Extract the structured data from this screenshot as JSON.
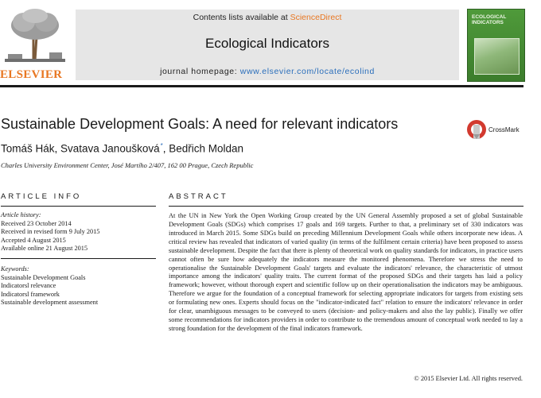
{
  "header": {
    "publisher_logo_text": "ELSEVIER",
    "contents_prefix": "Contents lists available at ",
    "contents_link": "ScienceDirect",
    "journal_name": "Ecological Indicators",
    "homepage_prefix": "journal homepage: ",
    "homepage_url": "www.elsevier.com/locate/ecolind",
    "cover_title": "ECOLOGICAL INDICATORS",
    "accent_color": "#e87722",
    "link_color": "#2a6ebb"
  },
  "article": {
    "title": "Sustainable Development Goals: A need for relevant indicators",
    "authors_a": "Tomáš Hák, Svatava Janoušková",
    "corresponding_mark": "*",
    "authors_b": ", Bedřich Moldan",
    "affiliation": "Charles University Environment Center, José Martího 2/407, 162 00 Prague, Czech Republic",
    "crossmark_label": "CrossMark"
  },
  "article_info": {
    "heading": "ARTICLE INFO",
    "history_label": "Article history:",
    "history": [
      "Received 23 October 2014",
      "Received in revised form 9 July 2015",
      "Accepted 4 August 2015",
      "Available online 21 August 2015"
    ],
    "keywords_label": "Keywords:",
    "keywords": [
      "Sustainable Development Goals",
      "Indicatorsl relevance",
      "Indicatorsl framework",
      "Sustainable development assessment"
    ]
  },
  "abstract": {
    "heading": "ABSTRACT",
    "text": "At the UN in New York the Open Working Group created by the UN General Assembly proposed a set of global Sustainable Development Goals (SDGs) which comprises 17 goals and 169 targets. Further to that, a preliminary set of 330 indicators was introduced in March 2015. Some SDGs build on preceding Millennium Development Goals while others incorporate new ideas. A critical review has revealed that indicators of varied quality (in terms of the fulfilment certain criteria) have been proposed to assess sustainable development. Despite the fact that there is plenty of theoretical work on quality standards for indicators, in practice users cannot often be sure how adequately the indicators measure the monitored phenomena. Therefore we stress the need to operationalise the Sustainable Development Goals' targets and evaluate the indicators' relevance, the characteristic of utmost importance among the indicators' quality traits. The current format of the proposed SDGs and their targets has laid a policy framework; however, without thorough expert and scientific follow up on their operationalisation the indicators may be ambiguous. Therefore we argue for the foundation of a conceptual framework for selecting appropriate indicators for targets from existing sets or formulating new ones. Experts should focus on the \"indicator-indicated fact\" relation to ensure the indicators' relevance in order for clear, unambiguous messages to be conveyed to users (decision- and policy-makers and also the lay public). Finally we offer some recommendations for indicators providers in order to contribute to the tremendous amount of conceptual work needed to lay a strong foundation for the development of the final indicators framework.",
    "copyright": "© 2015 Elsevier Ltd. All rights reserved."
  }
}
